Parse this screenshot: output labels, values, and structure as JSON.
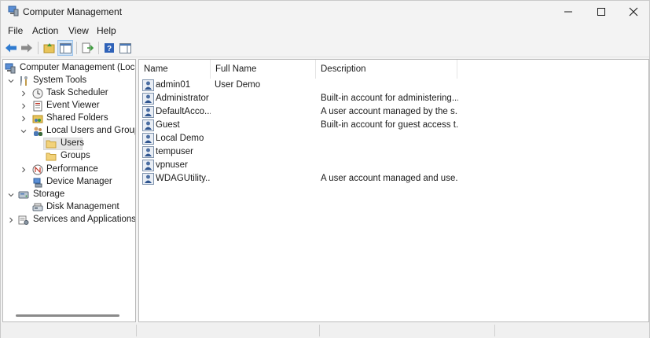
{
  "window": {
    "title": "Computer Management",
    "icon": "computer-management-icon"
  },
  "menu": {
    "items": [
      {
        "label": "File"
      },
      {
        "label": "Action"
      },
      {
        "label": "View"
      },
      {
        "label": "Help"
      }
    ]
  },
  "toolbar": {
    "buttons": [
      {
        "icon": "back-arrow-icon"
      },
      {
        "icon": "forward-arrow-icon"
      },
      {
        "icon": "up-folder-icon"
      },
      {
        "icon": "show-hide-console-tree-icon"
      },
      {
        "icon": "export-list-icon"
      },
      {
        "icon": "help-icon"
      },
      {
        "icon": "show-hide-action-pane-icon"
      }
    ]
  },
  "tree": {
    "items": [
      {
        "label": "Computer Management (Local",
        "icon": "computer-management-icon"
      },
      {
        "label": "System Tools",
        "icon": "tools-icon"
      },
      {
        "label": "Task Scheduler",
        "icon": "clock-icon"
      },
      {
        "label": "Event Viewer",
        "icon": "event-viewer-icon"
      },
      {
        "label": "Shared Folders",
        "icon": "shared-folder-icon"
      },
      {
        "label": "Local Users and Groups",
        "icon": "users-group-icon"
      },
      {
        "label": "Users",
        "icon": "folder-icon"
      },
      {
        "label": "Groups",
        "icon": "folder-icon"
      },
      {
        "label": "Performance",
        "icon": "performance-icon"
      },
      {
        "label": "Device Manager",
        "icon": "device-manager-icon"
      },
      {
        "label": "Storage",
        "icon": "storage-icon"
      },
      {
        "label": "Disk Management",
        "icon": "disk-icon"
      },
      {
        "label": "Services and Applications",
        "icon": "services-icon"
      }
    ],
    "selected": "Users"
  },
  "list": {
    "columns": [
      "Name",
      "Full Name",
      "Description"
    ],
    "rows": [
      {
        "name": "admin01",
        "full_name": "User Demo",
        "description": ""
      },
      {
        "name": "Administrator",
        "full_name": "",
        "description": "Built-in account for administering..."
      },
      {
        "name": "DefaultAcco...",
        "full_name": "",
        "description": "A user account managed by the s..."
      },
      {
        "name": "Guest",
        "full_name": "",
        "description": "Built-in account for guest access t..."
      },
      {
        "name": "Local Demo",
        "full_name": "",
        "description": ""
      },
      {
        "name": "tempuser",
        "full_name": "",
        "description": ""
      },
      {
        "name": "vpnuser",
        "full_name": "",
        "description": ""
      },
      {
        "name": "WDAGUtility...",
        "full_name": "",
        "description": "A user account managed and use..."
      }
    ]
  },
  "colors": {
    "window_bg": "#f3f3f3",
    "pane_bg": "#ffffff",
    "selection_bg": "#e5e5e5",
    "accent_blue": "#1e6fd0"
  }
}
